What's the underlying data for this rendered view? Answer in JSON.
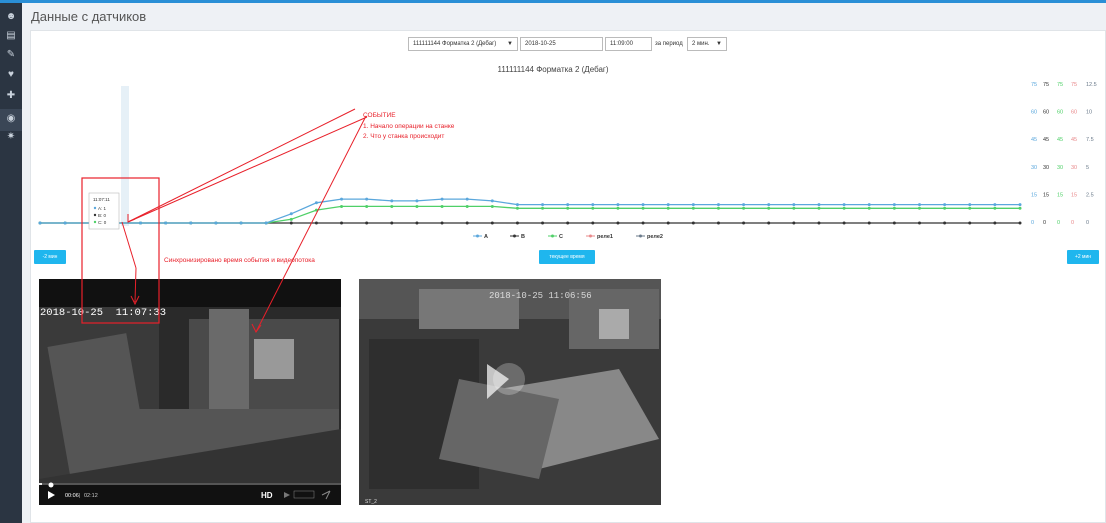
{
  "page": {
    "title": "Данные с датчиков"
  },
  "sidebar": {
    "icons": [
      {
        "name": "users-icon",
        "glyph": "☻"
      },
      {
        "name": "document-icon",
        "glyph": "▤"
      },
      {
        "name": "wrench-icon",
        "glyph": "✎"
      },
      {
        "name": "heart-icon",
        "glyph": "♥"
      },
      {
        "name": "tool-icon",
        "glyph": "✚"
      },
      {
        "name": "eye-icon",
        "glyph": "◉"
      },
      {
        "name": "settings-icon",
        "glyph": "✷"
      }
    ]
  },
  "controls": {
    "machine_select": "111111144 Форматка 2 (Дебаг)",
    "date": "2018-10-25",
    "time": "11:09:00",
    "period_label": "за период",
    "period_select": "2 мин."
  },
  "buttons": {
    "prev": "-2 мин",
    "now": "текущее время",
    "next": "+2 мин"
  },
  "chart_data": {
    "type": "line",
    "title": "111111144 Форматка 2 (Дебаг)",
    "legend_position": "bottom-center",
    "series": [
      {
        "name": "A",
        "color": "#5aa7dc",
        "values": [
          0,
          0,
          0,
          0,
          0,
          0,
          0,
          0,
          0,
          0,
          5,
          11,
          13,
          13,
          12,
          12,
          13,
          13,
          12,
          10,
          10,
          10,
          10,
          10,
          10,
          10,
          10,
          10,
          10,
          10,
          10,
          10,
          10,
          10,
          10,
          10,
          10,
          10,
          10,
          10
        ]
      },
      {
        "name": "B",
        "color": "#333333",
        "values": [
          0,
          0,
          0,
          0,
          0,
          0,
          0,
          0,
          0,
          0,
          0,
          0,
          0,
          0,
          0,
          0,
          0,
          0,
          0,
          0,
          0,
          0,
          0,
          0,
          0,
          0,
          0,
          0,
          0,
          0,
          0,
          0,
          0,
          0,
          0,
          0,
          0,
          0,
          0,
          0
        ]
      },
      {
        "name": "C",
        "color": "#4fd068",
        "values": [
          0,
          0,
          0,
          0,
          0,
          0,
          0,
          0,
          0,
          0,
          2,
          7,
          9,
          9,
          9,
          9,
          9,
          9,
          9,
          8,
          8,
          8,
          8,
          8,
          8,
          8,
          8,
          8,
          8,
          8,
          8,
          8,
          8,
          8,
          8,
          8,
          8,
          8,
          8,
          8
        ]
      },
      {
        "name": "реле1",
        "color": "#e8888a",
        "values": []
      },
      {
        "name": "реле2",
        "color": "#6a7a8a",
        "values": []
      }
    ],
    "right_axes": [
      {
        "color": "#5aa7dc",
        "ticks": [
          "75",
          "60",
          "45",
          "30",
          "15",
          "0"
        ]
      },
      {
        "color": "#333333",
        "ticks": [
          "75",
          "60",
          "45",
          "30",
          "15",
          "0"
        ]
      },
      {
        "color": "#4fd068",
        "ticks": [
          "75",
          "60",
          "45",
          "30",
          "15",
          "0"
        ]
      },
      {
        "color": "#e8888a",
        "ticks": [
          "75",
          "60",
          "45",
          "30",
          "15",
          "0"
        ]
      },
      {
        "color": "#6a7a8a",
        "ticks": [
          "12.5",
          "10",
          "7.5",
          "5",
          "2.5",
          "0"
        ]
      }
    ],
    "tooltip": {
      "time": "11:07:11",
      "rows": [
        "A: 1",
        "B: 0",
        "C: 0"
      ]
    }
  },
  "annotations": {
    "event_title": "СОБЫТИЕ",
    "event_line1": "1. Начало операции на станке",
    "event_line2": "2. Что у станка происходит",
    "sync_text": "Синхронизировано время события и видеопотока"
  },
  "video1": {
    "overlay_time": "2018-10-25  11:07:33",
    "elapsed": "00:06",
    "duration": "02:12",
    "quality": "HD"
  },
  "video2": {
    "overlay_time": "2018-10-25 11:06:56",
    "camera_label": "ST_2"
  }
}
